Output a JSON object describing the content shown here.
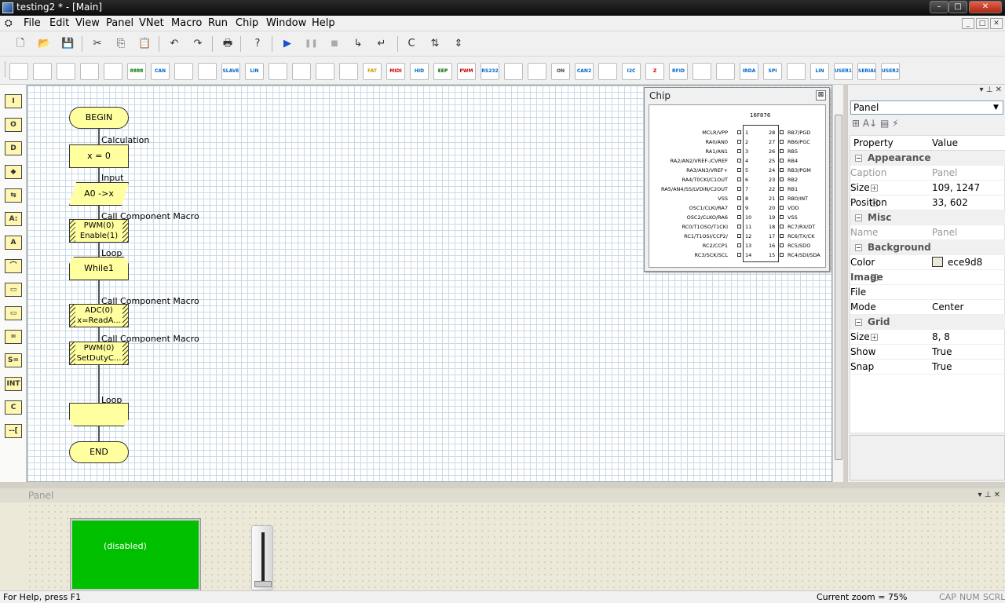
{
  "window": {
    "title": "testing2 * - [Main]",
    "minimize": "–",
    "maximize": "□",
    "close": "✕"
  },
  "menu": [
    "File",
    "Edit",
    "View",
    "Panel",
    "VNet",
    "Macro",
    "Run",
    "Chip",
    "Window",
    "Help"
  ],
  "mdi_buttons": [
    "_",
    "□",
    "✕"
  ],
  "toolbar1": {
    "icons": [
      "new-file-icon",
      "open-folder-icon",
      "save-icon",
      "cut-icon",
      "copy-icon",
      "paste-icon",
      "undo-icon",
      "redo-icon",
      "print-icon",
      "help-icon",
      "run-icon",
      "pause-icon",
      "stop-icon",
      "step-into-icon",
      "step-over-icon",
      "c-code-icon",
      "compile-icon",
      "chip-program-icon"
    ],
    "glyphs": [
      "🗋",
      "📂",
      "💾",
      "✂",
      "⎘",
      "📋",
      "↶",
      "↷",
      "🖶",
      "?",
      "▶",
      "❚❚",
      "■",
      "↳",
      "↵",
      "C",
      "⇅",
      "⇕"
    ]
  },
  "toolbar2": {
    "labels": [
      "",
      "",
      "",
      "",
      "",
      "8888",
      "CAN",
      "",
      "",
      "SLAVE",
      "LIN",
      "",
      "",
      "",
      "",
      "FAT",
      "MIDI",
      "HID",
      "EEP",
      "PWM",
      "RS232",
      "",
      "",
      "ON OFF",
      "CAN2",
      "",
      "I2C",
      "Z",
      "RFID",
      "",
      "",
      "IRDA",
      "SPI",
      "",
      "LIN",
      "USER1",
      "SERIAL",
      "USER2"
    ]
  },
  "left_icons": [
    "I",
    "O",
    "D",
    "◆",
    "⇆",
    "A:",
    "A",
    "⌒",
    "▭",
    "▭",
    "=",
    "S=",
    "INT",
    "C",
    "--["
  ],
  "flowchart": {
    "begin": "BEGIN",
    "end": "END",
    "steps": [
      {
        "label": "Calculation",
        "text1": "x = 0",
        "text2": ""
      },
      {
        "label": "Input",
        "text1": "A0 ->",
        "text2": "x"
      },
      {
        "label": "Call Component Macro",
        "text1": "PWM(0)",
        "text2": "Enable(1)"
      },
      {
        "label": "Loop",
        "text1": "While",
        "text2": "1"
      },
      {
        "label": "Call Component Macro",
        "text1": "ADC(0)",
        "text2": "x=ReadA..."
      },
      {
        "label": "Call Component Macro",
        "text1": "PWM(0)",
        "text2": "SetDutyC..."
      },
      {
        "label": "Loop",
        "text1": "",
        "text2": ""
      }
    ]
  },
  "chip": {
    "title": "Chip",
    "close": "⊠",
    "model": "16F876",
    "left_pins": [
      "MCLR/VPP",
      "RA0/AN0",
      "RA1/AN1",
      "RA2/AN2/VREF-/CVREF",
      "RA3/AN3/VREF+",
      "RA4/T0CKI/C1OUT",
      "RA5/AN4/SS/LVDIN/C2OUT",
      "VSS",
      "OSC1/CLKI/RA7",
      "OSC2/CLKO/RA6",
      "RC0/T1OSO/T1CKI",
      "RC1/T1OSI/CCP2/",
      "RC2/CCP1",
      "RC3/SCK/SCL"
    ],
    "left_nums": [
      "1",
      "2",
      "3",
      "4",
      "5",
      "6",
      "7",
      "8",
      "9",
      "10",
      "11",
      "12",
      "13",
      "14"
    ],
    "right_pins": [
      "RB7/PGD",
      "RB6/PGC",
      "RB5",
      "RB4",
      "RB3/PGM",
      "RB2",
      "RB1",
      "RB0/INT",
      "VDD",
      "VSS",
      "RC7/RX/DT",
      "RC6/TX/CK",
      "RC5/SDO",
      "RC4/SDI/SDA"
    ],
    "right_nums": [
      "28",
      "27",
      "26",
      "25",
      "24",
      "23",
      "22",
      "21",
      "20",
      "19",
      "18",
      "17",
      "16",
      "15"
    ]
  },
  "properties": {
    "header_icons": "▾ ⊥ ✕",
    "selected": "Panel",
    "tools": "⊞  A↓  ▤  ⚡",
    "col_property": "Property",
    "col_value": "Value",
    "rows": [
      {
        "cat": true,
        "name": "Appearance"
      },
      {
        "name": "Caption",
        "value": "Panel",
        "grey": true
      },
      {
        "name": "Size",
        "value": "109, 1247",
        "exp": "+"
      },
      {
        "name": "Position",
        "value": "33, 602",
        "exp": "+"
      },
      {
        "cat": true,
        "name": "Misc"
      },
      {
        "name": "Name",
        "value": "Panel",
        "grey": true
      },
      {
        "cat": true,
        "name": "Background"
      },
      {
        "name": "Color",
        "value": "ece9d8",
        "swatch": "#ece9d8"
      },
      {
        "name": "Image",
        "value": "",
        "exp": "−",
        "bold": true
      },
      {
        "name": "File",
        "value": "",
        "indent": true
      },
      {
        "name": "Mode",
        "value": "Center",
        "indent": true
      },
      {
        "cat": true,
        "name": "Grid"
      },
      {
        "name": "Size",
        "value": "8, 8",
        "exp": "+"
      },
      {
        "name": "Show",
        "value": "True"
      },
      {
        "name": "Snap",
        "value": "True"
      }
    ]
  },
  "panel": {
    "caption": "Panel",
    "header_icons": "▾ ⊥ ✕",
    "led_label": "(disabled)"
  },
  "status": {
    "help": "For Help, press F1",
    "zoom": "Current zoom = 75%",
    "cap": "CAP",
    "num": "NUM",
    "scrl": "SCRL"
  },
  "colors": {
    "led": "#00c000",
    "flow_fill": "#ffffa0",
    "panel_bg": "#ece9d8"
  }
}
